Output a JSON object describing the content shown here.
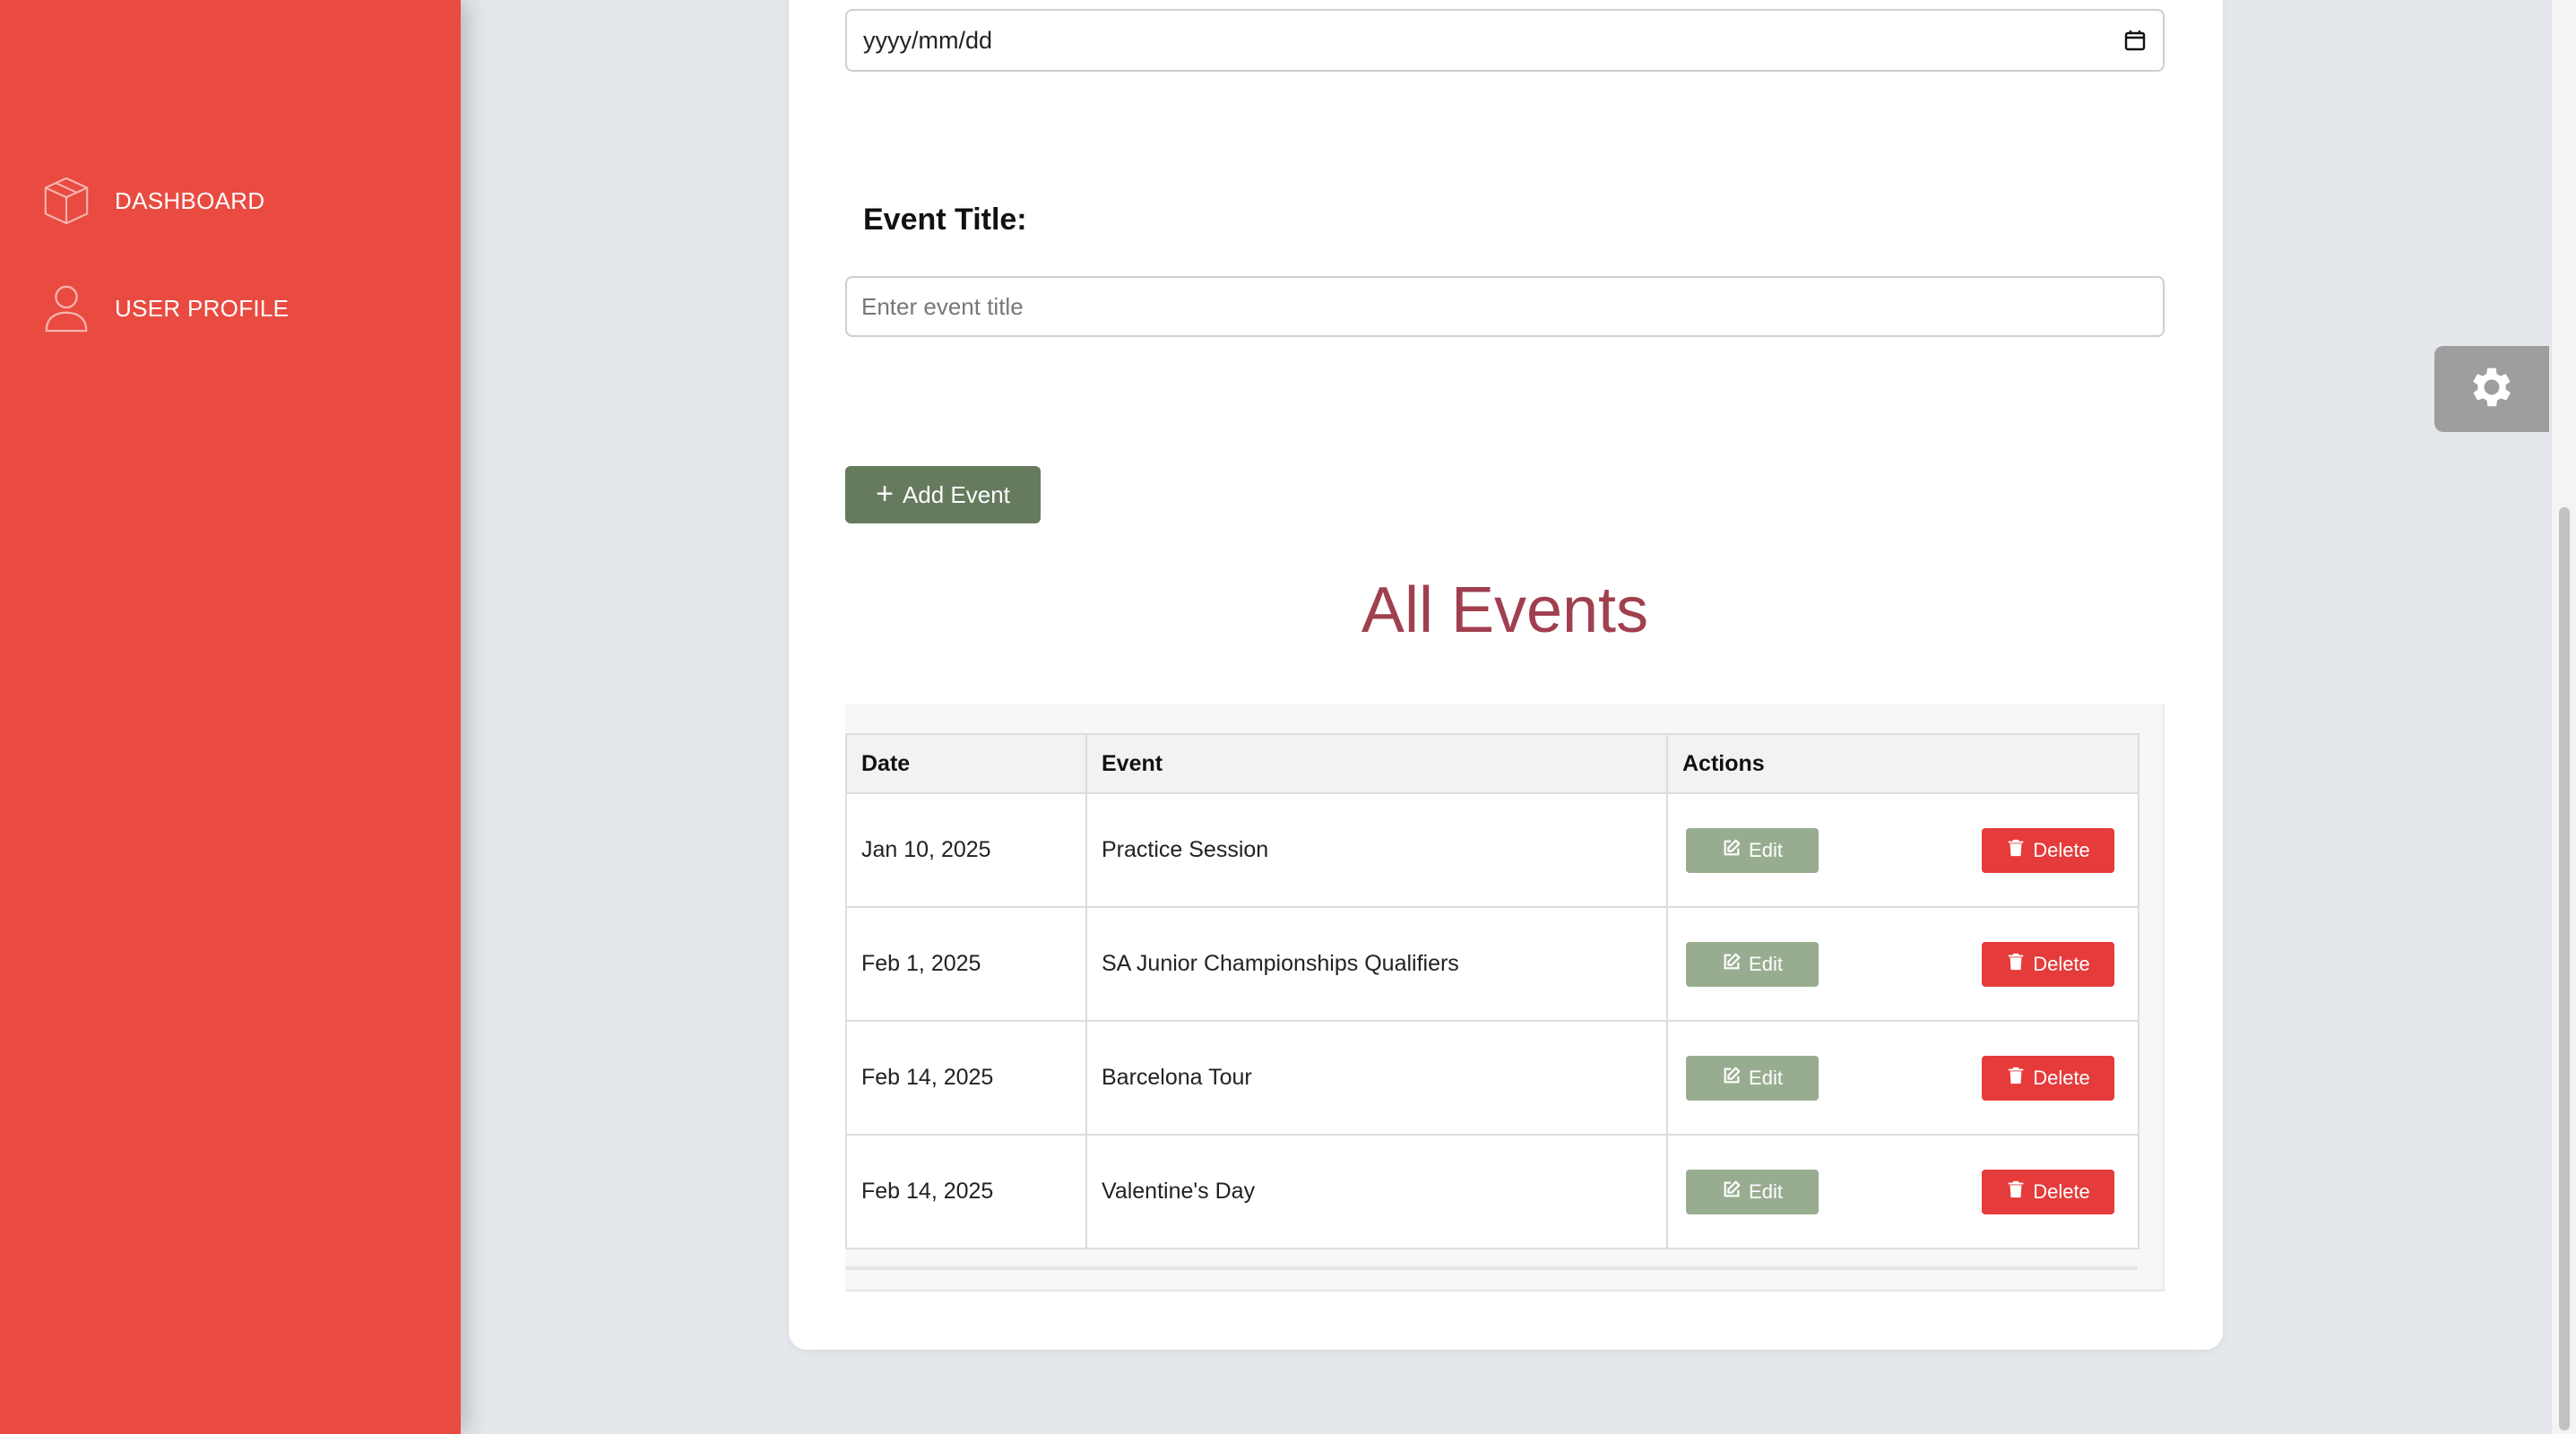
{
  "sidebar": {
    "items": [
      {
        "label": "DASHBOARD",
        "icon": "cube-icon"
      },
      {
        "label": "USER PROFILE",
        "icon": "user-icon"
      }
    ],
    "color": "#e94b41"
  },
  "form": {
    "date_placeholder": "yyyy/mm/dd",
    "title_label": "Event Title:",
    "title_placeholder": "Enter event title",
    "add_button": "Add Event"
  },
  "events": {
    "heading": "All Events",
    "columns": [
      "Date",
      "Event",
      "Actions"
    ],
    "edit_label": "Edit",
    "delete_label": "Delete",
    "rows": [
      {
        "date": "Jan 10, 2025",
        "event": "Practice Session"
      },
      {
        "date": "Feb 1, 2025",
        "event": "SA Junior Championships Qualifiers"
      },
      {
        "date": "Feb 14, 2025",
        "event": "Barcelona Tour"
      },
      {
        "date": "Feb 14, 2025",
        "event": "Valentine's Day"
      }
    ]
  },
  "colors": {
    "accent": "#e94b41",
    "heading": "#a0404f",
    "add_button": "#667a5e",
    "edit_button": "#98ad90",
    "delete_button": "#e53b3b"
  }
}
